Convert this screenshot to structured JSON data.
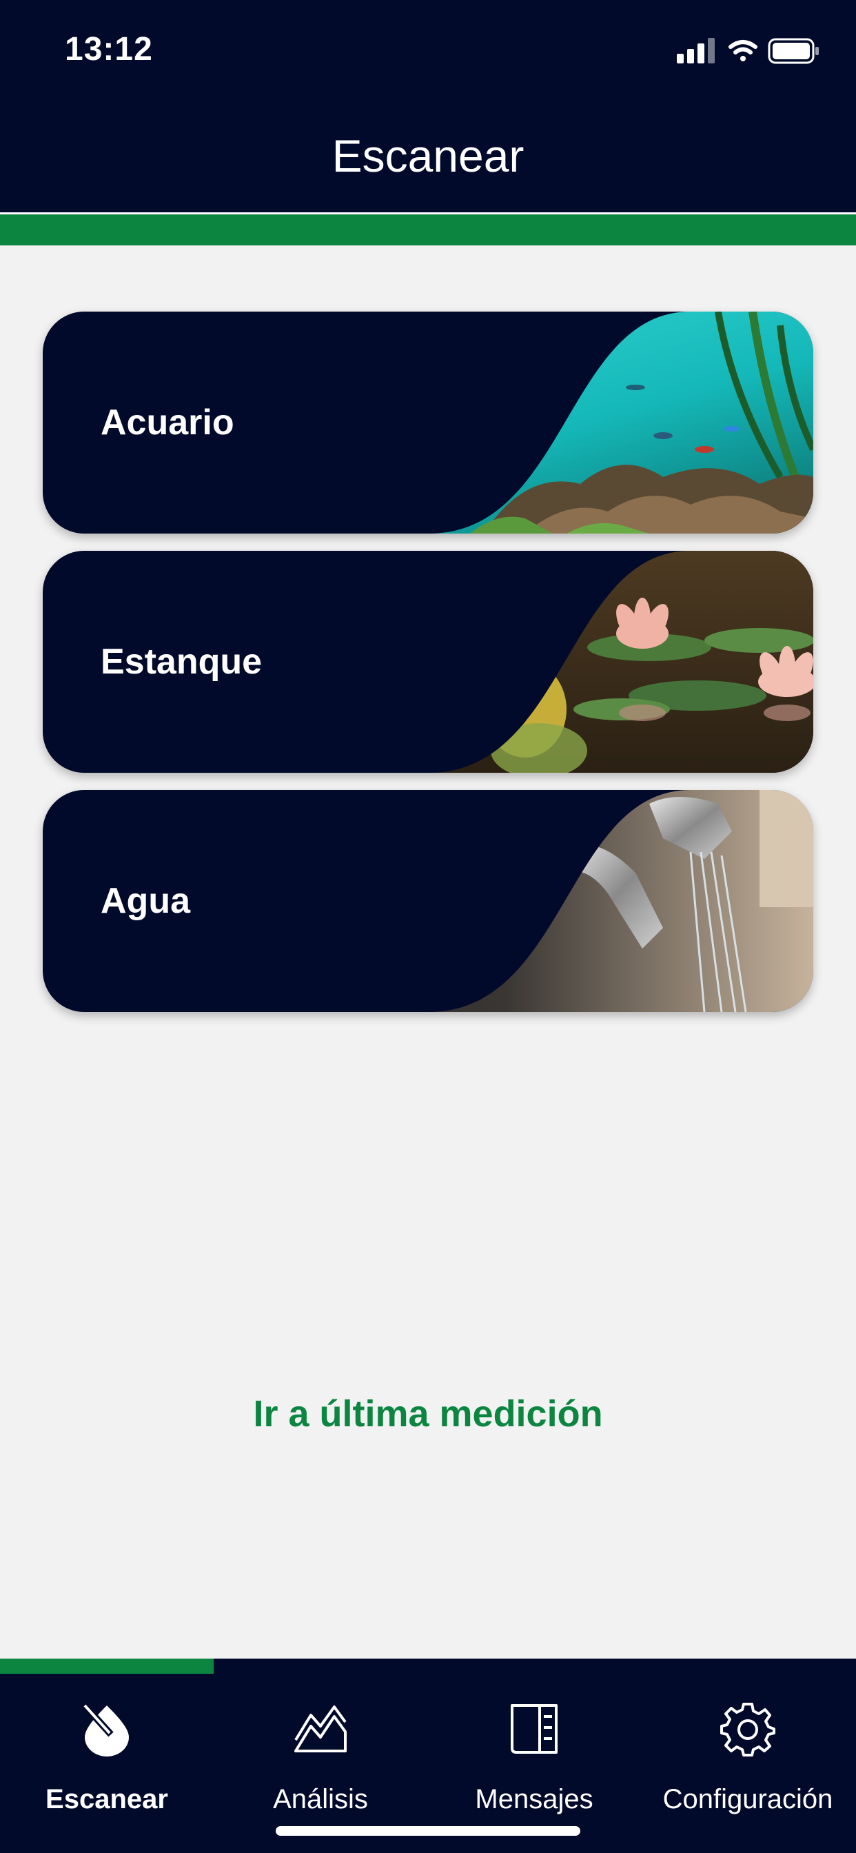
{
  "status": {
    "time": "13:12"
  },
  "header": {
    "title": "Escanear"
  },
  "cards": [
    {
      "label": "Acuario"
    },
    {
      "label": "Estanque"
    },
    {
      "label": "Agua"
    }
  ],
  "last_measurement_link": "Ir a última medición",
  "tabs": [
    {
      "label": "Escanear",
      "icon": "scan-drop-icon",
      "active": true
    },
    {
      "label": "Análisis",
      "icon": "analysis-chart-icon",
      "active": false
    },
    {
      "label": "Mensajes",
      "icon": "messages-icon",
      "active": false
    },
    {
      "label": "Configuración",
      "icon": "gear-icon",
      "active": false
    }
  ],
  "colors": {
    "navy": "#020a2b",
    "accent_green": "#0c8541",
    "background": "#f2f2f2"
  }
}
